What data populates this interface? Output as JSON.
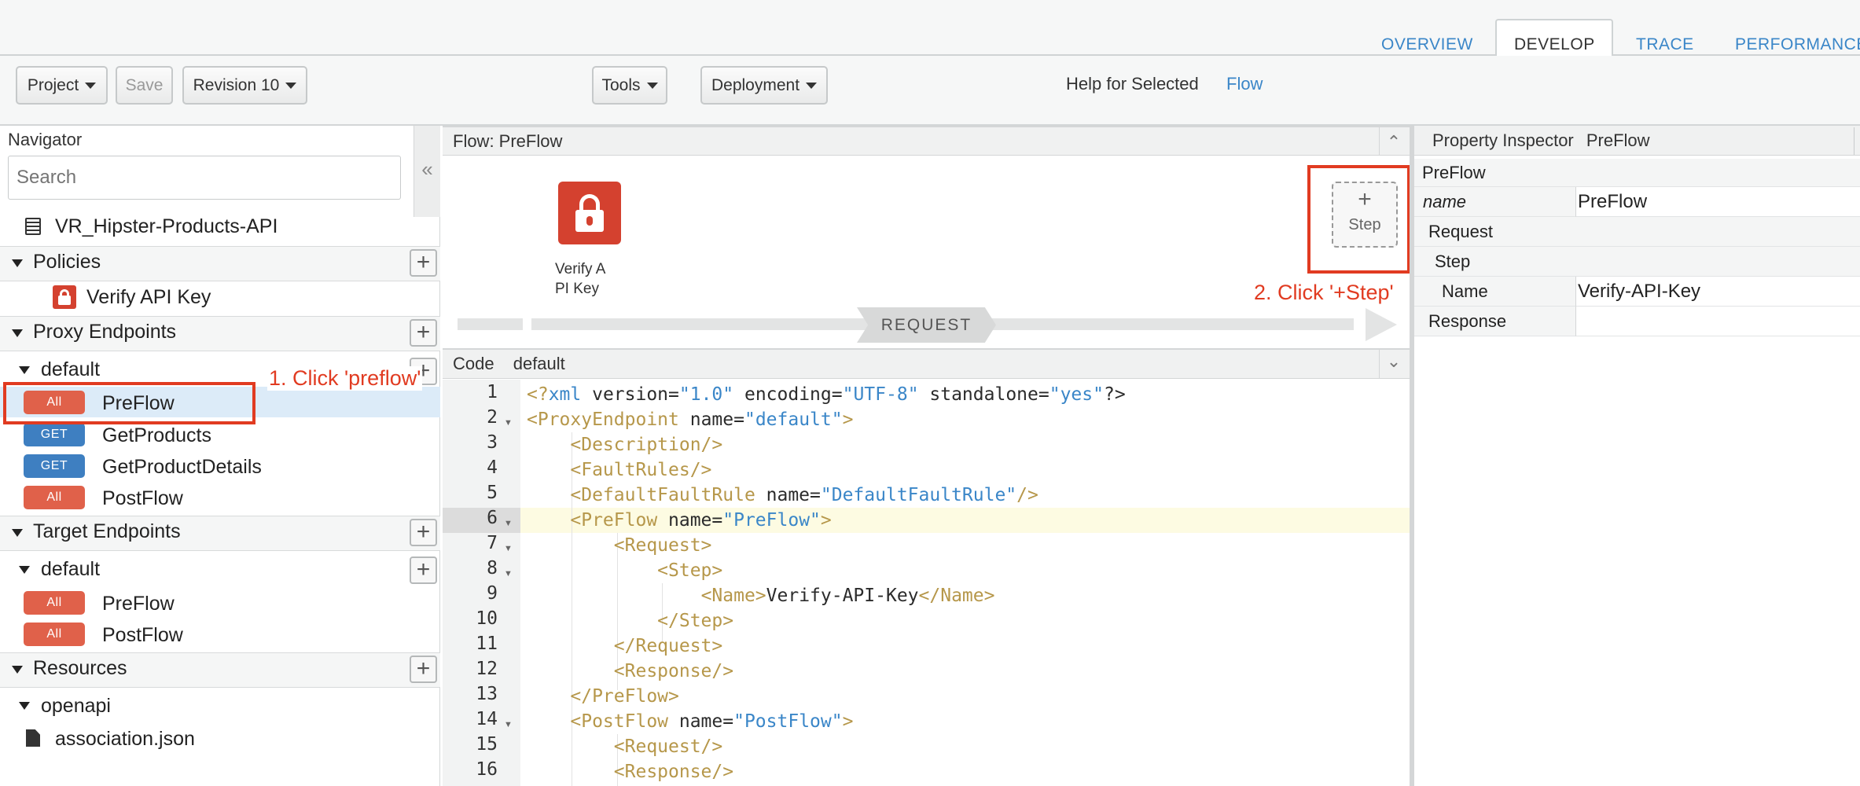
{
  "top_tabs": [
    "OVERVIEW",
    "DEVELOP",
    "TRACE",
    "PERFORMANCE"
  ],
  "toolbar": {
    "project": "Project",
    "save": "Save",
    "revision": "Revision 10",
    "tools": "Tools",
    "deployment": "Deployment",
    "help_label": "Help for Selected",
    "help_link": "Flow"
  },
  "navigator": {
    "title": "Navigator",
    "search_placeholder": "Search",
    "collapse_glyph": "«",
    "api_name": "VR_Hipster-Products-API",
    "policies": {
      "label": "Policies",
      "items": [
        "Verify API Key"
      ]
    },
    "proxy_endpoints": {
      "label": "Proxy Endpoints",
      "endpoint": "default",
      "flows": [
        {
          "badge": "All",
          "label": "PreFlow"
        },
        {
          "badge": "GET",
          "label": "GetProducts"
        },
        {
          "badge": "GET",
          "label": "GetProductDetails"
        },
        {
          "badge": "All",
          "label": "PostFlow"
        }
      ]
    },
    "target_endpoints": {
      "label": "Target Endpoints",
      "endpoint": "default",
      "flows": [
        {
          "badge": "All",
          "label": "PreFlow"
        },
        {
          "badge": "All",
          "label": "PostFlow"
        }
      ]
    },
    "resources": {
      "label": "Resources",
      "folder": "openapi",
      "file": "association.json"
    }
  },
  "flow_panel": {
    "title": "Flow: PreFlow",
    "policy_label": "Verify A\nPI Key",
    "step_plus": "+",
    "step_label": "Step",
    "request_label": "REQUEST"
  },
  "code_panel": {
    "title": "Code",
    "subtitle": "default",
    "line_numbers": [
      "1",
      "2",
      "3",
      "4",
      "5",
      "6",
      "7",
      "8",
      "9",
      "10",
      "11",
      "12",
      "13",
      "14",
      "15",
      "16"
    ]
  },
  "annotations": {
    "step1": "1. Click 'preflow'",
    "step2": "2. Click '+Step'"
  },
  "inspector": {
    "title": "Property Inspector",
    "subtitle": "PreFlow",
    "section": "PreFlow",
    "name_key": "name",
    "name_value": "PreFlow",
    "request": "Request",
    "step": "Step",
    "step_name_key": "Name",
    "step_name_value": "Verify-API-Key",
    "response": "Response"
  },
  "colors": {
    "accent": "#3a86c8",
    "annotation": "#e13b21",
    "badge_all": "#e0614a",
    "badge_get": "#3e7fc1",
    "policy_icon": "#d4412f"
  }
}
